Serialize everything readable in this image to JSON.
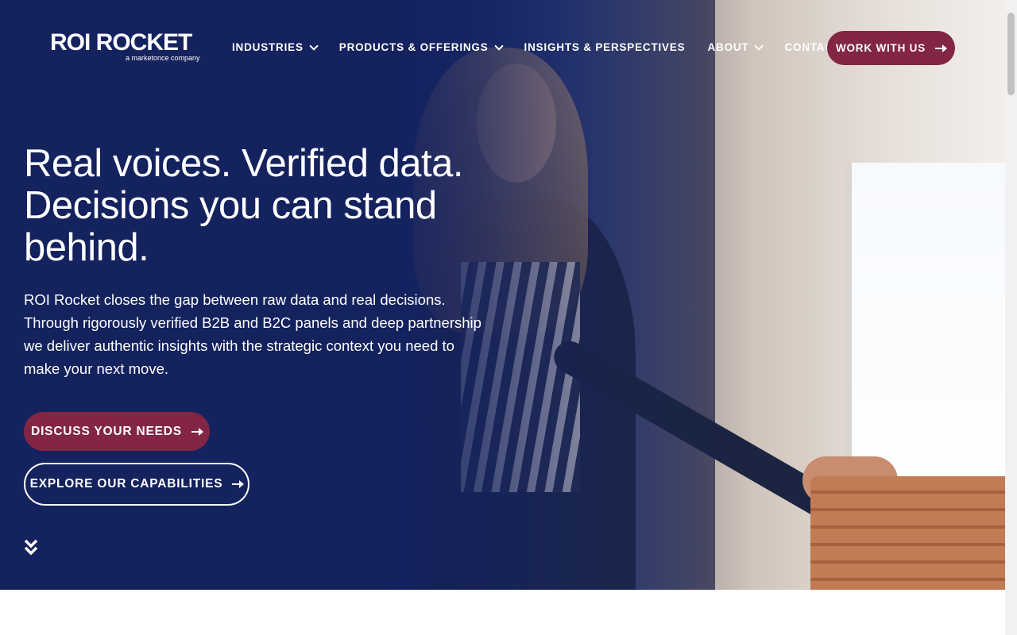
{
  "brand": {
    "name": "ROI ROCKET",
    "tagline": "a marketonce company"
  },
  "nav": {
    "items": [
      {
        "label": "INDUSTRIES",
        "dropdown": true
      },
      {
        "label": "PRODUCTS & OFFERINGS",
        "dropdown": true
      },
      {
        "label": "INSIGHTS & PERSPECTIVES",
        "dropdown": false
      },
      {
        "label": "ABOUT",
        "dropdown": true
      },
      {
        "label": "CONTACT US",
        "dropdown": false
      }
    ],
    "cta_label": "WORK WITH US"
  },
  "hero": {
    "headline": "Real voices. Verified data. Decisions you can stand behind.",
    "lead": "ROI Rocket closes the gap between raw data and real decisions. Through rigorously verified B2B and B2C panels and deep partnership we deliver authentic insights with the strategic context you need to make your next move.",
    "primary_cta": "DISCUSS YOUR NEEDS",
    "secondary_cta": "EXPLORE OUR CAPABILITIES"
  },
  "colors": {
    "navy": "#14225e",
    "accent": "#822643",
    "text": "#ffffff"
  },
  "icons": {
    "scroll": "double-chevron-down-icon",
    "arrow": "arrow-right-icon",
    "dropdown": "chevron-down-icon"
  }
}
